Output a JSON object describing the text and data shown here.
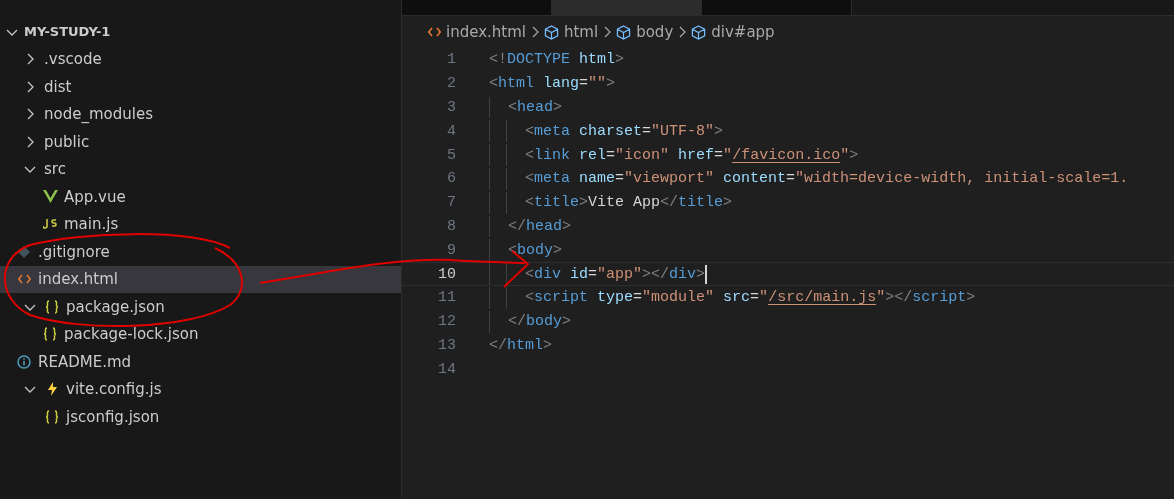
{
  "explorer": {
    "root": {
      "label": "MY-STUDY-1",
      "expanded": true,
      "children": [
        {
          "label": ".vscode",
          "kind": "folder",
          "expanded": false,
          "selected": false
        },
        {
          "label": "dist",
          "kind": "folder",
          "expanded": false,
          "selected": false
        },
        {
          "label": "node_modules",
          "kind": "folder",
          "expanded": false,
          "selected": false
        },
        {
          "label": "public",
          "kind": "folder",
          "expanded": false,
          "selected": false
        },
        {
          "label": "src",
          "kind": "folder",
          "expanded": true,
          "selected": false,
          "children": [
            {
              "label": "App.vue",
              "kind": "vue",
              "selected": false
            },
            {
              "label": "main.js",
              "kind": "js",
              "selected": false
            }
          ]
        },
        {
          "label": ".gitignore",
          "kind": "git",
          "selected": false
        },
        {
          "label": "index.html",
          "kind": "html",
          "selected": true
        },
        {
          "label": "package.json",
          "kind": "json",
          "expanded": true,
          "selected": false,
          "children": [
            {
              "label": "package-lock.json",
              "kind": "json",
              "selected": false
            }
          ]
        },
        {
          "label": "README.md",
          "kind": "info",
          "selected": false
        },
        {
          "label": "vite.config.js",
          "kind": "vite",
          "expanded": true,
          "selected": false,
          "children": [
            {
              "label": "jsconfig.json",
              "kind": "json",
              "selected": false
            }
          ]
        }
      ]
    }
  },
  "tabs": [
    {
      "selected": false
    },
    {
      "selected": true
    },
    {
      "selected": false
    }
  ],
  "breadcrumb": [
    {
      "label": "index.html",
      "kind": "file"
    },
    {
      "label": "html",
      "kind": "element"
    },
    {
      "label": "body",
      "kind": "element"
    },
    {
      "label": "div#app",
      "kind": "element"
    }
  ],
  "editor": {
    "lines": [
      {
        "number": "1",
        "current": false,
        "tokens": [
          {
            "t": "<!",
            "kind": "punct"
          },
          {
            "t": "DOCTYPE",
            "kind": "tag"
          },
          {
            "t": " html",
            "kind": "attr"
          },
          {
            "t": ">",
            "kind": "punct"
          }
        ]
      },
      {
        "number": "2",
        "current": false,
        "tokens": [
          {
            "t": "<",
            "kind": "punct"
          },
          {
            "t": "html",
            "kind": "tag"
          },
          {
            "t": " lang",
            "kind": "attr"
          },
          {
            "t": "=",
            "kind": "text"
          },
          {
            "t": "\"\"",
            "kind": "string"
          },
          {
            "t": ">",
            "kind": "punct"
          }
        ],
        "children": [
          {
            "number": "3",
            "current": false,
            "tokens": [
              {
                "t": "<",
                "kind": "punct"
              },
              {
                "t": "head",
                "kind": "tag"
              },
              {
                "t": ">",
                "kind": "punct"
              }
            ],
            "children": [
              {
                "number": "4",
                "current": false,
                "tokens": [
                  {
                    "t": "<",
                    "kind": "punct"
                  },
                  {
                    "t": "meta",
                    "kind": "tag"
                  },
                  {
                    "t": " charset",
                    "kind": "attr"
                  },
                  {
                    "t": "=",
                    "kind": "text"
                  },
                  {
                    "t": "\"UTF-8\"",
                    "kind": "string"
                  },
                  {
                    "t": ">",
                    "kind": "punct"
                  }
                ]
              },
              {
                "number": "5",
                "current": false,
                "tokens": [
                  {
                    "t": "<",
                    "kind": "punct"
                  },
                  {
                    "t": "link",
                    "kind": "tag"
                  },
                  {
                    "t": " rel",
                    "kind": "attr"
                  },
                  {
                    "t": "=",
                    "kind": "text"
                  },
                  {
                    "t": "\"icon\"",
                    "kind": "string"
                  },
                  {
                    "t": " href",
                    "kind": "attr"
                  },
                  {
                    "t": "=",
                    "kind": "text"
                  },
                  {
                    "t": "\"",
                    "kind": "string"
                  },
                  {
                    "t": "/favicon.ico",
                    "kind": "link"
                  },
                  {
                    "t": "\"",
                    "kind": "string"
                  },
                  {
                    "t": ">",
                    "kind": "punct"
                  }
                ]
              },
              {
                "number": "6",
                "current": false,
                "tokens": [
                  {
                    "t": "<",
                    "kind": "punct"
                  },
                  {
                    "t": "meta",
                    "kind": "tag"
                  },
                  {
                    "t": " name",
                    "kind": "attr"
                  },
                  {
                    "t": "=",
                    "kind": "text"
                  },
                  {
                    "t": "\"viewport\"",
                    "kind": "string"
                  },
                  {
                    "t": " content",
                    "kind": "attr"
                  },
                  {
                    "t": "=",
                    "kind": "text"
                  },
                  {
                    "t": "\"width=device-width, initial-scale=1.",
                    "kind": "string"
                  }
                ]
              },
              {
                "number": "7",
                "current": false,
                "tokens": [
                  {
                    "t": "<",
                    "kind": "punct"
                  },
                  {
                    "t": "title",
                    "kind": "tag"
                  },
                  {
                    "t": ">",
                    "kind": "punct"
                  },
                  {
                    "t": "Vite App",
                    "kind": "text"
                  },
                  {
                    "t": "</",
                    "kind": "punct"
                  },
                  {
                    "t": "title",
                    "kind": "tag"
                  },
                  {
                    "t": ">",
                    "kind": "punct"
                  }
                ]
              }
            ]
          },
          {
            "number": "8",
            "current": false,
            "tokens": [
              {
                "t": "</",
                "kind": "punct"
              },
              {
                "t": "head",
                "kind": "tag"
              },
              {
                "t": ">",
                "kind": "punct"
              }
            ]
          },
          {
            "number": "9",
            "current": false,
            "tokens": [
              {
                "t": "<",
                "kind": "punct"
              },
              {
                "t": "body",
                "kind": "tag"
              },
              {
                "t": ">",
                "kind": "punct"
              }
            ],
            "children": [
              {
                "number": "10",
                "current": true,
                "tokens": [
                  {
                    "t": "<",
                    "kind": "punct"
                  },
                  {
                    "t": "div",
                    "kind": "tag"
                  },
                  {
                    "t": " id",
                    "kind": "attr"
                  },
                  {
                    "t": "=",
                    "kind": "text"
                  },
                  {
                    "t": "\"app\"",
                    "kind": "string"
                  },
                  {
                    "t": "></",
                    "kind": "punct"
                  },
                  {
                    "t": "div",
                    "kind": "tag"
                  },
                  {
                    "t": ">",
                    "kind": "punct"
                  }
                ]
              },
              {
                "number": "11",
                "current": false,
                "tokens": [
                  {
                    "t": "<",
                    "kind": "punct"
                  },
                  {
                    "t": "script",
                    "kind": "tag"
                  },
                  {
                    "t": " type",
                    "kind": "attr"
                  },
                  {
                    "t": "=",
                    "kind": "text"
                  },
                  {
                    "t": "\"module\"",
                    "kind": "string"
                  },
                  {
                    "t": " src",
                    "kind": "attr"
                  },
                  {
                    "t": "=",
                    "kind": "text"
                  },
                  {
                    "t": "\"",
                    "kind": "string"
                  },
                  {
                    "t": "/src/main.js",
                    "kind": "link"
                  },
                  {
                    "t": "\"",
                    "kind": "string"
                  },
                  {
                    "t": "></",
                    "kind": "punct"
                  },
                  {
                    "t": "script",
                    "kind": "tag"
                  },
                  {
                    "t": ">",
                    "kind": "punct"
                  }
                ]
              }
            ]
          },
          {
            "number": "12",
            "current": false,
            "tokens": [
              {
                "t": "</",
                "kind": "punct"
              },
              {
                "t": "body",
                "kind": "tag"
              },
              {
                "t": ">",
                "kind": "punct"
              }
            ]
          }
        ]
      },
      {
        "number": "13",
        "current": false,
        "tokens": [
          {
            "t": "</",
            "kind": "punct"
          },
          {
            "t": "html",
            "kind": "tag"
          },
          {
            "t": ">",
            "kind": "punct"
          }
        ]
      },
      {
        "number": "14",
        "current": false
      }
    ]
  }
}
